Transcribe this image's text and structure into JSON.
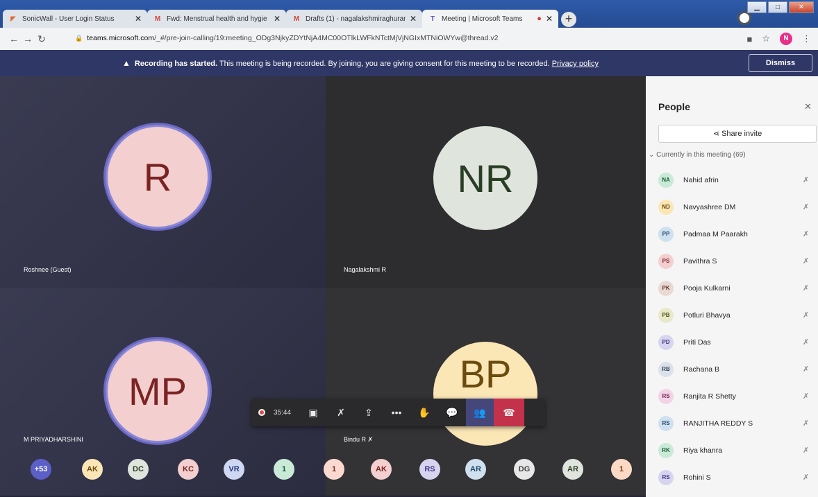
{
  "browser": {
    "tabs": [
      {
        "title": "SonicWall - User Login Status",
        "fav_color": "#e06a2c",
        "fav": "◤"
      },
      {
        "title": "Fwd: Menstrual health and hygie",
        "fav_color": "#d44638",
        "fav": "M"
      },
      {
        "title": "Drafts (1) - nagalakshmiraghurar",
        "fav_color": "#d44638",
        "fav": "M"
      },
      {
        "title": "Meeting | Microsoft Teams",
        "fav_color": "#5558af",
        "fav": "T"
      }
    ],
    "url": {
      "host": "teams.microsoft.com",
      "path": "/_#/pre-join-calling/19:meeting_ODg3NjkyZDYtNjA4MC00OTlkLWFkNTctMjVjNGIxMTNiOWYw@thread.v2"
    },
    "profile_initial": "N"
  },
  "banner": {
    "bold": "Recording has started.",
    "text": " This meeting is being recorded. By joining, you are giving consent for this meeting to be recorded. ",
    "link": "Privacy policy",
    "dismiss": "Dismiss"
  },
  "tiles": [
    {
      "initials": "R",
      "name": "Roshnee (Guest)",
      "circle_bg": "#f3cfcf",
      "text_color": "#7b2323",
      "ring": true
    },
    {
      "initials": "NR",
      "name": "Nagalakshmi R",
      "circle_bg": "#dfe5dc",
      "text_color": "#2a3d25",
      "ring": false
    },
    {
      "initials": "MP",
      "name": "M PRIYADHARSHINI",
      "circle_bg": "#f3cfcf",
      "text_color": "#7b2323",
      "ring": true
    },
    {
      "initials": "BP",
      "name": "Bindu R",
      "circle_bg": "#fbe6b6",
      "text_color": "#6b4b0e",
      "ring": false
    }
  ],
  "controls": {
    "timer": "35:44"
  },
  "strip": [
    {
      "label": "+53",
      "bg": "#5b5fc7",
      "fg": "#ffffff"
    },
    {
      "label": "AK",
      "bg": "#fbe6b6",
      "fg": "#6b4b0e"
    },
    {
      "label": "DC",
      "bg": "#dfe5dc",
      "fg": "#2a3d25"
    },
    {
      "label": "KC",
      "bg": "#f3cfcf",
      "fg": "#7b2323"
    },
    {
      "label": "VR",
      "bg": "#cfd8f3",
      "fg": "#23347b"
    },
    {
      "label": "1",
      "bg": "#c9ead7",
      "fg": "#1e5a3a"
    },
    {
      "label": "1",
      "bg": "#fcd9d0",
      "fg": "#7b3020"
    },
    {
      "label": "AK",
      "bg": "#f3cfcf",
      "fg": "#7b2323"
    },
    {
      "label": "RS",
      "bg": "#d7d4f0",
      "fg": "#3c3580"
    },
    {
      "label": "AR",
      "bg": "#cfe0ef",
      "fg": "#1f4766"
    },
    {
      "label": "DG",
      "bg": "#e7e7e7",
      "fg": "#444444"
    },
    {
      "label": "AR",
      "bg": "#dfe5dc",
      "fg": "#2a3d25"
    },
    {
      "label": "1",
      "bg": "#fbd9c4",
      "fg": "#7b3c16"
    }
  ],
  "panel": {
    "title": "People",
    "share": "Share invite",
    "section": "Currently in this meeting (69)",
    "people": [
      {
        "initials": "NA",
        "name": "Nahid afrin",
        "bg": "#c9ead7",
        "fg": "#1e5a3a"
      },
      {
        "initials": "ND",
        "name": "Navyashree DM",
        "bg": "#fbe6b6",
        "fg": "#6b4b0e"
      },
      {
        "initials": "PP",
        "name": "Padmaa M Paarakh",
        "bg": "#cfe0ef",
        "fg": "#1f4766"
      },
      {
        "initials": "PS",
        "name": "Pavithra S",
        "bg": "#f3cfcf",
        "fg": "#7b2323"
      },
      {
        "initials": "PK",
        "name": "Pooja Kulkarni",
        "bg": "#ead9d3",
        "fg": "#5c3a2c"
      },
      {
        "initials": "PB",
        "name": "Potluri Bhavya",
        "bg": "#e7e9c9",
        "fg": "#4a4e16"
      },
      {
        "initials": "PD",
        "name": "Priti Das",
        "bg": "#d7d4f0",
        "fg": "#3c3580"
      },
      {
        "initials": "RB",
        "name": "Rachana B",
        "bg": "#dbe1ea",
        "fg": "#2e3c55"
      },
      {
        "initials": "RS",
        "name": "Ranjita R Shetty",
        "bg": "#f3d4e6",
        "fg": "#6f2150"
      },
      {
        "initials": "RS",
        "name": "RANJITHA REDDY S",
        "bg": "#cfe0ef",
        "fg": "#1f4766"
      },
      {
        "initials": "RK",
        "name": "Riya khanra",
        "bg": "#c9ead7",
        "fg": "#1e5a3a"
      },
      {
        "initials": "RS",
        "name": "Rohini S",
        "bg": "#d7d4f0",
        "fg": "#3c3580"
      }
    ]
  }
}
